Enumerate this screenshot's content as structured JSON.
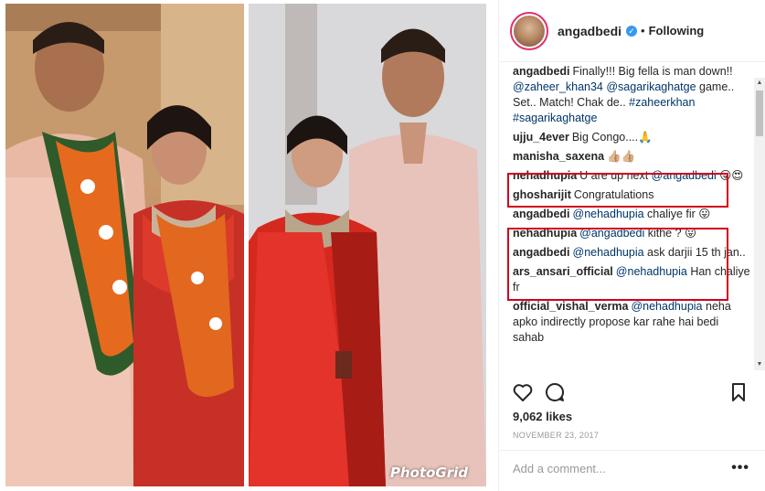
{
  "photo": {
    "watermark": "PhotoGrid"
  },
  "header": {
    "username": "angadbedi",
    "separator": "•",
    "follow_status": "Following"
  },
  "comments": [
    {
      "user": "angadbedi",
      "parts": [
        {
          "t": "Finally!!! Big fella is man down!! "
        },
        {
          "t": "@zaheer_khan34",
          "m": true
        },
        {
          "t": " "
        },
        {
          "t": "@sagarikaghatge",
          "m": true
        },
        {
          "t": " game.. Set.. Match! Chak de.. "
        },
        {
          "t": "#zaheerkhan",
          "m": true
        },
        {
          "t": " "
        },
        {
          "t": "#sagarikaghatge",
          "m": true
        }
      ]
    },
    {
      "user": "ujju_4ever",
      "parts": [
        {
          "t": "Big Congo....🙏"
        }
      ]
    },
    {
      "user": "manisha_saxena",
      "parts": [
        {
          "t": "👍🏼👍🏼"
        }
      ]
    },
    {
      "user": "nehadhupia",
      "parts": [
        {
          "t": "U are up next "
        },
        {
          "t": "@angadbedi",
          "m": true
        },
        {
          "t": " 😛😍"
        }
      ]
    },
    {
      "user": "ghosharijit",
      "parts": [
        {
          "t": "Congratulations"
        }
      ]
    },
    {
      "user": "angadbedi",
      "parts": [
        {
          "t": "@nehadhupia",
          "m": true
        },
        {
          "t": " chaliye fir 😛"
        }
      ]
    },
    {
      "user": "nehadhupia",
      "parts": [
        {
          "t": "@angadbedi",
          "m": true
        },
        {
          "t": " kithe ? 😛"
        }
      ]
    },
    {
      "user": "angadbedi",
      "parts": [
        {
          "t": "@nehadhupia",
          "m": true
        },
        {
          "t": " ask darjii 15 th jan.."
        }
      ]
    },
    {
      "user": "ars_ansari_official",
      "parts": [
        {
          "t": "@nehadhupia",
          "m": true
        },
        {
          "t": " Han chaliye fr"
        }
      ]
    },
    {
      "user": "official_vishal_verma",
      "parts": [
        {
          "t": "@nehadhupia",
          "m": true
        },
        {
          "t": " neha apko indirectly propose kar rahe hai bedi sahab"
        }
      ]
    }
  ],
  "likes": "9,062 likes",
  "date": "NOVEMBER 23, 2017",
  "add_comment": {
    "placeholder": "Add a comment..."
  },
  "more_label": "•••",
  "scroll": {
    "up": "▲",
    "down": "▼"
  },
  "colors": {
    "highlight": "#d0021b",
    "mention": "#003569",
    "verified": "#3897f0"
  }
}
